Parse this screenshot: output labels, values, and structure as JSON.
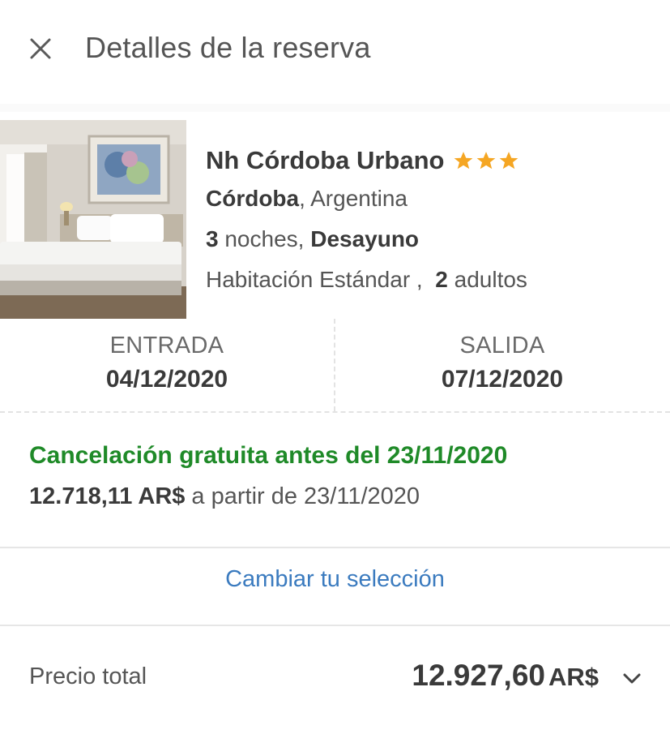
{
  "header": {
    "title": "Detalles de la reserva",
    "close_icon": "close-icon"
  },
  "hotel": {
    "name": "Nh Córdoba Urbano",
    "stars": 3,
    "star_color": "#f5a623",
    "city": "Córdoba",
    "country_suffix": ", Argentina",
    "nights_count": "3",
    "nights_label": "noches,",
    "board": "Desayuno",
    "room_type": "Habitación Estándar ,",
    "adults_count": "2",
    "adults_label": "adultos"
  },
  "dates": {
    "checkin_label": "ENTRADA",
    "checkin_value": "04/12/2020",
    "checkout_label": "SALIDA",
    "checkout_value": "07/12/2020"
  },
  "policy": {
    "free_cancellation": "Cancelación gratuita antes del 23/11/2020",
    "fee_amount": "12.718,11 AR$",
    "fee_text": "a partir de 23/11/2020",
    "accent_color": "#1f8a28"
  },
  "actions": {
    "change_selection": "Cambiar tu selección",
    "link_color": "#3b7bbf"
  },
  "total": {
    "label": "Precio total",
    "amount": "12.927,60",
    "currency": "AR$",
    "expand_icon": "chevron-down-icon"
  }
}
